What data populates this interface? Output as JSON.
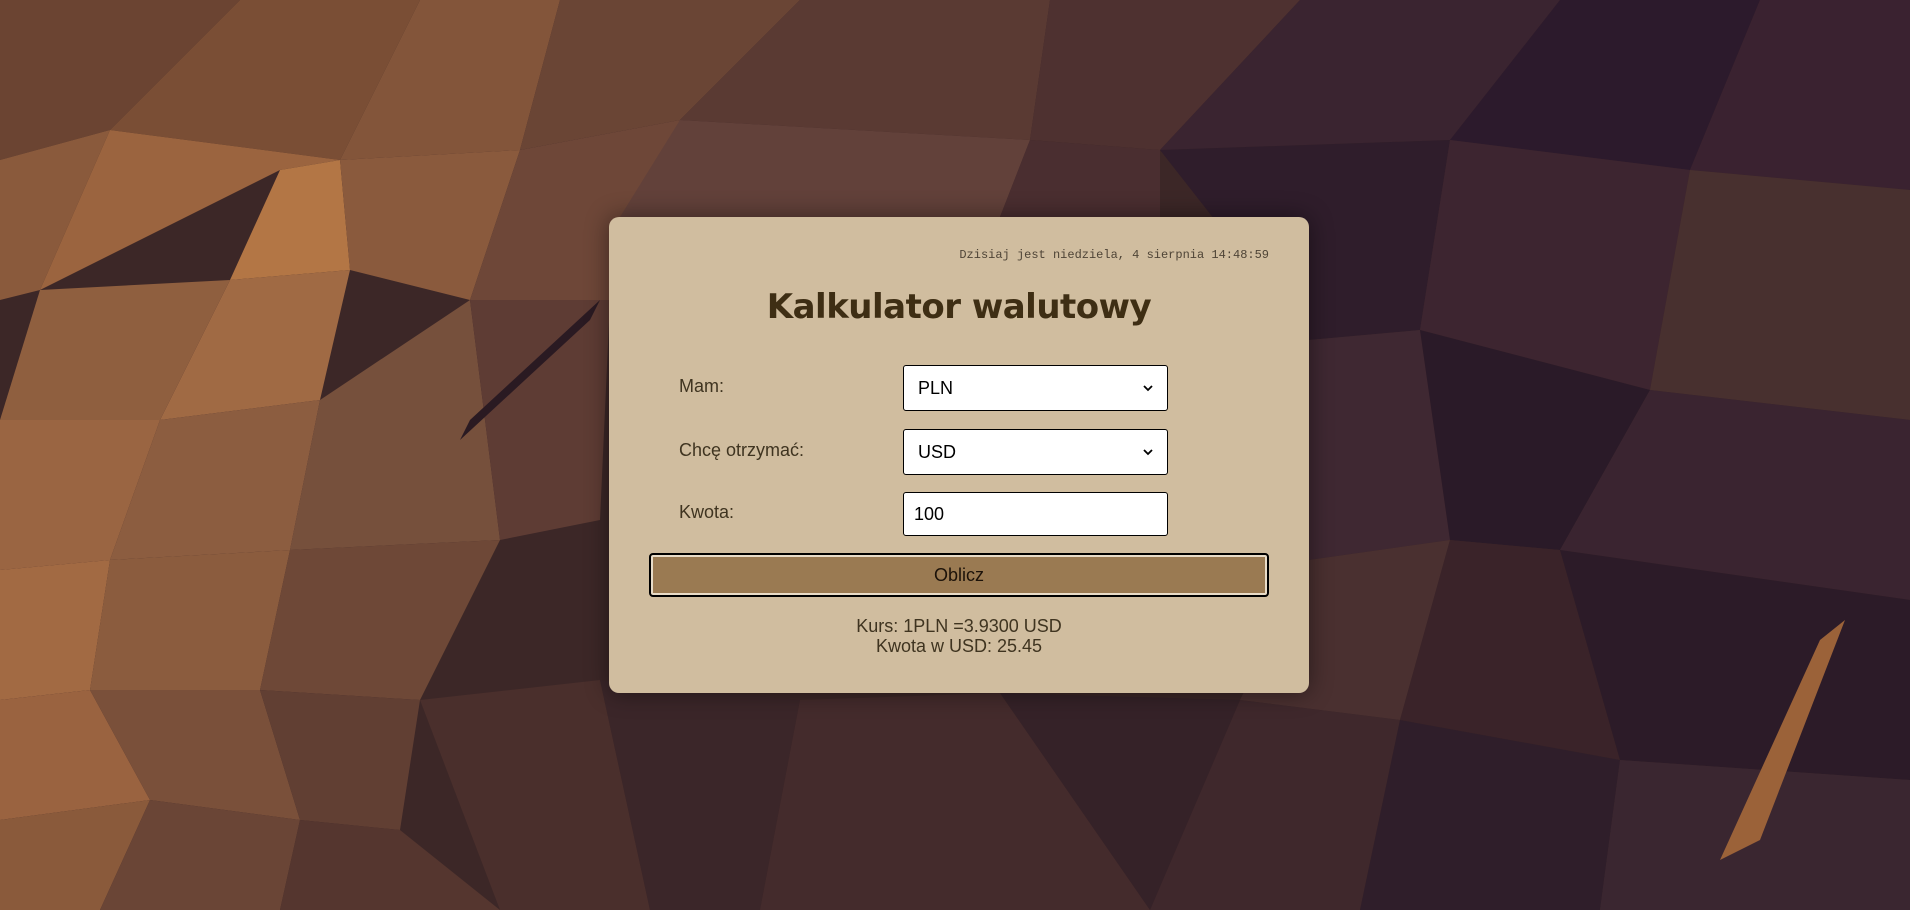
{
  "header": {
    "datetime": "Dzisiaj jest niedziela, 4 sierpnia 14:48:59",
    "title": "Kalkulator walutowy"
  },
  "form": {
    "have_label": "Mam:",
    "have_value": "PLN",
    "want_label": "Chcę otrzymać:",
    "want_value": "USD",
    "amount_label": "Kwota:",
    "amount_value": "100",
    "submit_label": "Oblicz"
  },
  "result": {
    "rate_text": "Kurs: 1PLN =3.9300 USD",
    "amount_text": "Kwota w USD: 25.45"
  },
  "colors": {
    "card_background": "#d0bd9f",
    "button_background": "#9a7a52",
    "title_color": "#3e2e14"
  }
}
